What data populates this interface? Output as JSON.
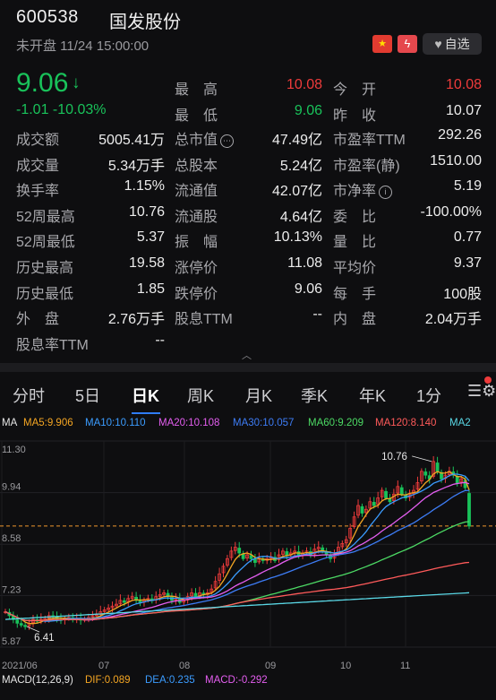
{
  "header": {
    "code": "600538",
    "name": "国发股份",
    "status": "未开盘 11/24 15:00:00",
    "flag_icon": "china-flag-icon",
    "bolt_icon": "lightning-icon",
    "fav_label": "自选"
  },
  "quote": {
    "price": "9.06",
    "arrow": "↓",
    "change": "-1.01 -10.03%"
  },
  "stats": [
    {
      "label": "最　高",
      "value": "10.08",
      "color": "red"
    },
    {
      "label": "今　开",
      "value": "10.08",
      "color": "red"
    },
    {
      "label": "最　低",
      "value": "9.06",
      "color": "green"
    },
    {
      "label": "昨　收",
      "value": "10.07",
      "color": ""
    },
    {
      "label": "成交额",
      "value": "5005.41万"
    },
    {
      "label": "总市值",
      "value": "47.49亿"
    },
    {
      "label": "市盈率TTM",
      "value": "292.26"
    },
    {
      "label": "成交量",
      "value": "5.34万手"
    },
    {
      "label": "总股本",
      "value": "5.24亿"
    },
    {
      "label": "市盈率(静)",
      "value": "1510.00"
    },
    {
      "label": "换手率",
      "value": "1.15%"
    },
    {
      "label": "流通值",
      "value": "42.07亿"
    },
    {
      "label": "市净率",
      "value": "5.19"
    },
    {
      "label": "52周最高",
      "value": "10.76"
    },
    {
      "label": "流通股",
      "value": "4.64亿"
    },
    {
      "label": "委　比",
      "value": "-100.00%"
    },
    {
      "label": "52周最低",
      "value": "5.37"
    },
    {
      "label": "振　幅",
      "value": "10.13%"
    },
    {
      "label": "量　比",
      "value": "0.77"
    },
    {
      "label": "历史最高",
      "value": "19.58"
    },
    {
      "label": "涨停价",
      "value": "11.08"
    },
    {
      "label": "平均价",
      "value": "9.37"
    },
    {
      "label": "历史最低",
      "value": "1.85"
    },
    {
      "label": "跌停价",
      "value": "9.06"
    },
    {
      "label": "每　手",
      "value": "100股"
    },
    {
      "label": "外　盘",
      "value": "2.76万手"
    },
    {
      "label": "股息TTM",
      "value": "--"
    },
    {
      "label": "内　盘",
      "value": "2.04万手"
    },
    {
      "label": "股息率TTM",
      "value": "--"
    }
  ],
  "tabs": [
    "分时",
    "5日",
    "日K",
    "周K",
    "月K",
    "季K",
    "年K",
    "1分"
  ],
  "active_tab": "日K",
  "ma": [
    {
      "label": "MA",
      "color": "#e6e6e6"
    },
    {
      "label": "MA5:9.906",
      "color": "#f5a623"
    },
    {
      "label": "MA10:10.110",
      "color": "#3b9cff"
    },
    {
      "label": "MA20:10.108",
      "color": "#e45ef0"
    },
    {
      "label": "MA30:10.057",
      "color": "#3d7cf5"
    },
    {
      "label": "MA60:9.209",
      "color": "#4cd964"
    },
    {
      "label": "MA120:8.140",
      "color": "#ff5a5a"
    },
    {
      "label": "MA2",
      "color": "#5ad8e6"
    }
  ],
  "macd": [
    {
      "label": "MACD(12,26,9)",
      "color": "#e6e6e6"
    },
    {
      "label": "DIF:0.089",
      "color": "#f5a623"
    },
    {
      "label": "DEA:0.235",
      "color": "#3b9cff"
    },
    {
      "label": "MACD:-0.292",
      "color": "#e45ef0"
    }
  ],
  "chart_data": {
    "type": "candlestick",
    "y_ticks": [
      "11.30",
      "9.94",
      "8.58",
      "7.23",
      "5.87"
    ],
    "x_ticks": [
      "2021/06",
      "07",
      "08",
      "09",
      "10",
      "11"
    ],
    "ylim": [
      5.87,
      11.3
    ],
    "annotations": [
      {
        "label": "10.76",
        "x_label": "11",
        "value": 10.76
      },
      {
        "label": "6.41",
        "x_label": "2021/06",
        "value": 6.41
      }
    ],
    "reference_line": {
      "value": 9.06,
      "label": "",
      "color": "#f0962d"
    },
    "closes": [
      6.8,
      6.7,
      6.6,
      6.5,
      6.45,
      6.41,
      6.5,
      6.6,
      6.55,
      6.6,
      6.62,
      6.7,
      6.68,
      6.6,
      6.58,
      6.62,
      6.65,
      6.6,
      6.62,
      6.58,
      6.6,
      6.65,
      6.7,
      6.72,
      6.8,
      6.85,
      6.9,
      6.95,
      7.0,
      7.1,
      7.05,
      7.15,
      7.2,
      7.1,
      7.05,
      7.1,
      7.15,
      7.1,
      7.2,
      7.25,
      7.3,
      7.2,
      7.1,
      7.15,
      7.05,
      7.1,
      7.2,
      7.3,
      7.2,
      7.3,
      7.25,
      7.3,
      7.4,
      7.6,
      7.8,
      8.0,
      8.2,
      8.4,
      8.5,
      8.35,
      8.2,
      8.3,
      8.2,
      8.1,
      8.2,
      8.15,
      8.2,
      8.25,
      8.15,
      8.3,
      8.4,
      8.3,
      8.35,
      8.4,
      8.3,
      8.35,
      8.4,
      8.3,
      8.45,
      8.5,
      8.4,
      8.3,
      8.2,
      8.3,
      8.5,
      8.6,
      8.7,
      9.0,
      9.3,
      9.6,
      9.4,
      9.5,
      9.7,
      9.6,
      9.8,
      10.0,
      9.8,
      9.7,
      9.9,
      10.1,
      9.9,
      9.8,
      9.9,
      10.0,
      10.2,
      10.5,
      10.4,
      10.3,
      10.76,
      10.5,
      10.3,
      10.4,
      10.5,
      10.4,
      10.2,
      10.3,
      10.07,
      9.06
    ],
    "ma_lines": [
      {
        "name": "MA5",
        "color": "#f5a623",
        "end": 9.906
      },
      {
        "name": "MA10",
        "color": "#3b9cff",
        "end": 10.11
      },
      {
        "name": "MA20",
        "color": "#e45ef0",
        "end": 10.108
      },
      {
        "name": "MA30",
        "color": "#3d7cf5",
        "end": 10.057
      },
      {
        "name": "MA60",
        "color": "#4cd964",
        "end": 9.209
      },
      {
        "name": "MA120",
        "color": "#ff5a5a",
        "end": 8.14
      }
    ]
  }
}
